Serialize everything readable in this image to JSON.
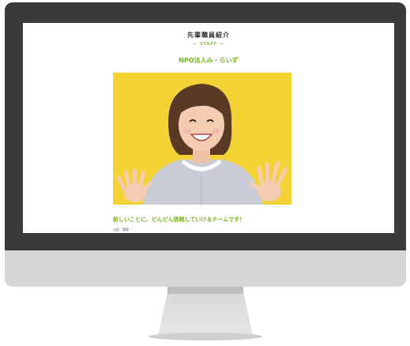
{
  "page": {
    "title": "先輩職員紹介",
    "subtitle": "— STAFF —",
    "organization": "NPO法人み・らいず",
    "catchphrase": "新しいことに、どんどん挑戦していけるチームです！",
    "staff_line": "山田　陽菜"
  },
  "colors": {
    "accent_green": "#7ab41e",
    "photo_background": "#f3d235",
    "bezel": "#3a3a3a",
    "chin": "#d6d6d6"
  },
  "icons": {
    "monitor": "monitor-icon"
  }
}
